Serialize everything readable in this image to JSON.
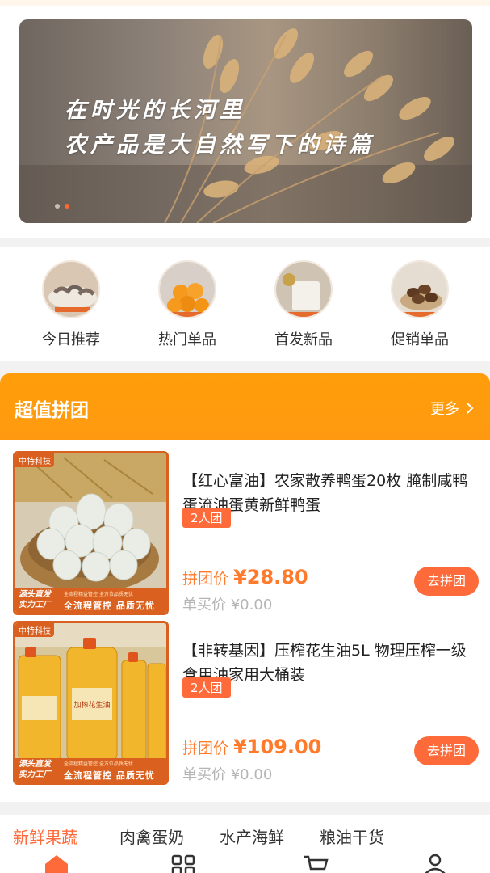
{
  "banner": {
    "line1": "在时光的长河里",
    "line2": "农产品是大自然写下的诗篇",
    "dots": 2,
    "active_dot": 2
  },
  "categories": [
    {
      "label": "今日推荐",
      "icon": "shrimp-icon"
    },
    {
      "label": "热门单品",
      "icon": "oranges-icon"
    },
    {
      "label": "首发新品",
      "icon": "rice-icon"
    },
    {
      "label": "促销单品",
      "icon": "mushroom-icon"
    }
  ],
  "group_buy": {
    "title": "超值拼团",
    "more": "更多",
    "products": [
      {
        "title": "【红心富油】农家散养鸭蛋20枚 腌制咸鸭蛋流油蛋黄新鲜鸭蛋",
        "tag": "2人团",
        "group_price_label": "拼团价",
        "group_price": "¥28.80",
        "single_price_label": "单买价",
        "single_price": "¥0.00",
        "button": "去拼团",
        "image_badge": "中特科技",
        "image_footer_left": "源头直发 实力工厂",
        "image_footer_small": "全流程精益管控  全方位品质无忧",
        "image_footer_main": "全流程管控  品质无忧"
      },
      {
        "title": "【非转基因】压榨花生油5L 物理压榨一级食用油家用大桶装",
        "tag": "2人团",
        "group_price_label": "拼团价",
        "group_price": "¥109.00",
        "single_price_label": "单买价",
        "single_price": "¥0.00",
        "button": "去拼团",
        "image_badge": "中特科技",
        "image_label": "加榨花生油",
        "image_footer_left": "源头直发 实力工厂",
        "image_footer_small": "全流程精益管控  全方位品质无忧",
        "image_footer_main": "全流程管控  品质无忧"
      }
    ]
  },
  "tabs": [
    "新鲜果蔬",
    "肉禽蛋奶",
    "水产海鲜",
    "粮油干货"
  ],
  "active_tab": 0,
  "bottom_nav": [
    "home-icon",
    "category-grid-icon",
    "cart-icon",
    "profile-icon"
  ],
  "colors": {
    "accent": "#ff6a3a",
    "header": "#ff9d0a"
  }
}
